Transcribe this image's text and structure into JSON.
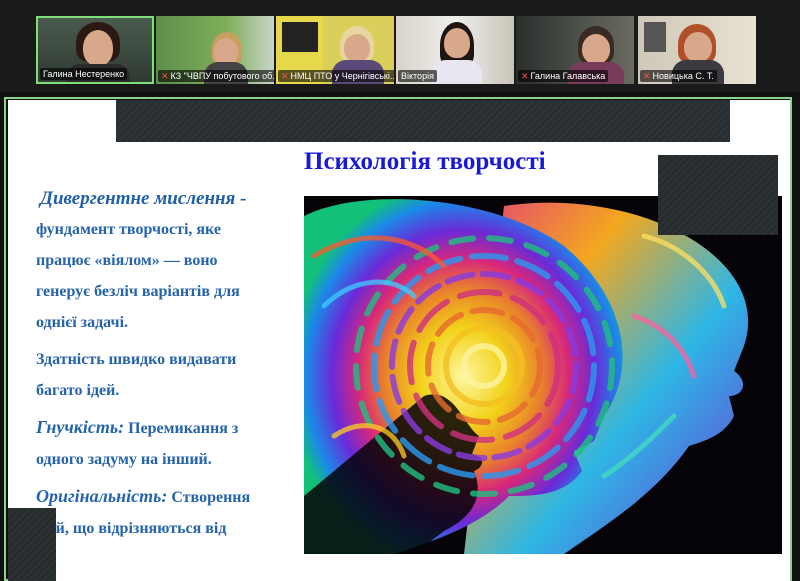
{
  "participants": [
    {
      "name": "Галина Нестеренко",
      "muted": false,
      "active": true
    },
    {
      "name": "КЗ \"ЧВПУ побутового об...",
      "muted": true,
      "active": false
    },
    {
      "name": "НМЦ ПТО у Чернігівські...",
      "muted": true,
      "active": false
    },
    {
      "name": "Вікторія",
      "muted": true,
      "active": false
    },
    {
      "name": "Галина Галавська",
      "muted": true,
      "active": false
    },
    {
      "name": "Новицька С. Т.",
      "muted": true,
      "active": false
    }
  ],
  "slide": {
    "title": "Психологія творчості",
    "heading": "Дивергентне мислення -",
    "lines": [
      "фундамент творчості, яке",
      "працює «віялом» — воно",
      "генерує безліч варіантів для",
      "однієї задачі."
    ],
    "lines2": [
      "Здатність швидко видавати",
      "багато ідей."
    ],
    "flex_term": "Гнучкість:",
    "flex_text": " Перемикання з",
    "flex_line2": "одного задуму на інший.",
    "orig_term": "Оригінальність:",
    "orig_text": " Створення",
    "orig_line2": "ідей, що відрізняються від"
  },
  "colors": {
    "active_border": "#7fe07a",
    "title": "#1a1ad6",
    "text": "#2563ab"
  }
}
